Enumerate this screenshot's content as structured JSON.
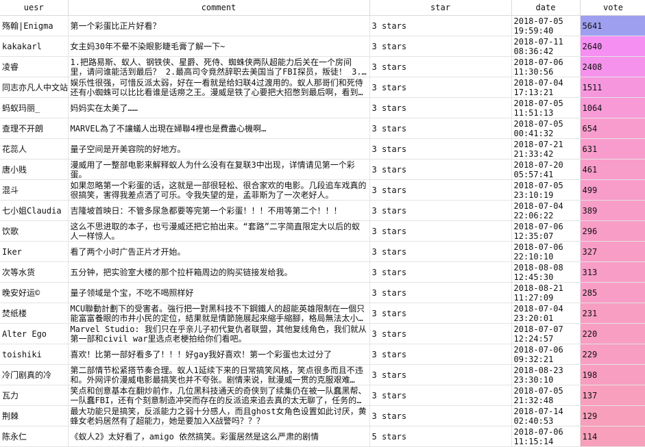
{
  "columns": [
    "uesr",
    "comment",
    "star",
    "date",
    "vote"
  ],
  "rows": [
    {
      "user": "殇翰|Enigma",
      "comment": "第一个彩蛋比正片好看？",
      "star": "3 stars",
      "date": "2018-07-05 19:59:40",
      "vote": "5641",
      "color": "#9f9ff0"
    },
    {
      "user": "kakakarl",
      "comment": "女主妈30年不晕不染眼影睫毛膏了解一下~",
      "star": "3 stars",
      "date": "2018-07-11 08:36:42",
      "vote": "2640",
      "color": "#f58ff2"
    },
    {
      "user": "凌睿",
      "comment": "1.把路易斯、蚁人、钢铁侠、星爵、死侍、蜘蛛侠两队超能力后关在一个房间里，请问谁能活到最后？ 2.最高司令竟然辞职去美国当了FBI探员，叛徒！ 3.…",
      "star": "3 stars",
      "date": "2018-07-06 11:30:56",
      "vote": "2408",
      "color": "#f593ec"
    },
    {
      "user": "同志亦凡人中文站",
      "comment": "娱乐性很强，可惜反派太弱，好在一看就是给妇联4过渡用的。蚁人那哥们和死侍还有小蜘蛛可以比比看谁是话痨之王。漫威是铁了心要把大招憋到最后啊，看到…",
      "star": "3 stars",
      "date": "2018-07-04 17:13:21",
      "vote": "1511",
      "color": "#f697de"
    },
    {
      "user": "蚂蚁玛丽_",
      "comment": "妈妈实在太美了……",
      "star": "3 stars",
      "date": "2018-07-05 11:51:13",
      "vote": "1064",
      "color": "#f79ad6"
    },
    {
      "user": "查理不开朗",
      "comment": "MARVEL為了不讓蟻人出現在婦聯4裡也是費盡心機啊…",
      "star": "3 stars",
      "date": "2018-07-05 00:41:32",
      "vote": "654",
      "color": "#f89ccd"
    },
    {
      "user": "花蕊人",
      "comment": "量子空间是开美容院的好地方。",
      "star": "3 stars",
      "date": "2018-07-21 21:33:42",
      "vote": "631",
      "color": "#f89ccd"
    },
    {
      "user": "唐小贱",
      "comment": "漫威用了一整部电影来解释蚁人为什么没有在复联3中出现，详情请见第一个彩蛋。",
      "star": "3 stars",
      "date": "2018-07-20 05:57:41",
      "vote": "461",
      "color": "#f89cca"
    },
    {
      "user": "混斗",
      "comment": "如果忽略第一个彩蛋的话，这就是一部很轻松、很合家欢的电影。几段追车戏真的很搞笑，害得我差点洒了可乐。令我失望的是，孟菲斯为了一次老好人。",
      "star": "3 stars",
      "date": "2018-07-05 23:10:19",
      "vote": "499",
      "color": "#f89cca"
    },
    {
      "user": "七小姐Claudia",
      "comment": "吉隆坡首映日：不管多尿急都要等完第一个彩蛋！！！不用等第二个！！！",
      "star": "3 stars",
      "date": "2018-07-04 22:06:22",
      "vote": "389",
      "color": "#f89dc8"
    },
    {
      "user": "饮歌",
      "comment": "这么不思进取的本子，也亏漫威还把它拍出来。“套路”二字简直限定大以后的蚁人一样惊人。",
      "star": "3 stars",
      "date": "2018-07-06 12:35:07",
      "vote": "296",
      "color": "#f89dc6"
    },
    {
      "user": "Iker",
      "comment": "看了两个小时广告正片才开始。",
      "star": "3 stars",
      "date": "2018-07-06 22:10:10",
      "vote": "327",
      "color": "#f89dc6"
    },
    {
      "user": "次等水货",
      "comment": "五分钟，把实验室大楼的那个拉杆箱周边的购买链接发给我。",
      "star": "3 stars",
      "date": "2018-08-08 12:45:30",
      "vote": "313",
      "color": "#f89dc6"
    },
    {
      "user": "晚安好运©",
      "comment": "量子领域是个宝，不吃不喝照样好",
      "star": "3 stars",
      "date": "2018-08-21 11:27:09",
      "vote": "285",
      "color": "#f89dc5"
    },
    {
      "user": "焚纸楼",
      "comment": "MCU聯動計劃下的受害者。強行把一對黑科技不下鋼鐵人的超能英雄限制在一個只能富富養眼的市井小民的定位，結果就是情節施展起來縮手縮腳，格局無法太小…",
      "star": "3 stars",
      "date": "2018-07-04 23:20:01",
      "vote": "231",
      "color": "#f89ec2"
    },
    {
      "user": "Alter Ego",
      "comment": "Marvel Studio: 我们只在乎亲儿子初代复仇者联盟，其他复线角色，我们就从第一部和civil war里选点老梗拍给你们看吧。",
      "star": "3 stars",
      "date": "2018-07-07 12:24:57",
      "vote": "220",
      "color": "#f89ec2"
    },
    {
      "user": "toishiki",
      "comment": "喜欢！比第一部好看多了！！！好gay我好喜欢！第一个彩蛋也太过分了",
      "star": "3 stars",
      "date": "2018-07-06 09:32:21",
      "vote": "229",
      "color": "#f89ec2"
    },
    {
      "user": "冷门剧真的冷",
      "comment": "第二部情节松紧搭节奏合理。蚁人1延续下来的日常搞笑风格，笑点很多而且不违和。外网评价漫威电影最搞笑也并不夸张。剧情来说，就漫威一贯的克服艰难…",
      "star": "3 stars",
      "date": "2018-08-23 23:30:10",
      "vote": "198",
      "color": "#f89ec0"
    },
    {
      "user": "瓦力",
      "comment": "笑点和创意基本在翻炒前作，几位黑科技通天的奇侠到了续集仍在被一队蠢黑帮、一队蠢FBI，还有个刻意制造冲突而存在的反派追来追去真的太无聊了，任务的…",
      "star": "3 stars",
      "date": "2018-07-05 21:32:48",
      "vote": "137",
      "color": "#f89fbd"
    },
    {
      "user": "荆棘",
      "comment": "最大功能只是搞笑，反派能力之弱十分感人，而且ghost女角色设置如此讨厌，黄蜂女老妈居然有了超能力，她是要加入X战警吗？？？",
      "star": "3 stars",
      "date": "2018-07-14 02:40:53",
      "vote": "129",
      "color": "#f89fbc"
    },
    {
      "user": "陈永仁",
      "comment": "《蚁人2》太好看了，amigo 依然搞笑。彩蛋居然是这么严肃的剧情",
      "star": "5 stars",
      "date": "2018-07-06 11:15:14",
      "vote": "114",
      "color": "#f89fbb"
    }
  ]
}
